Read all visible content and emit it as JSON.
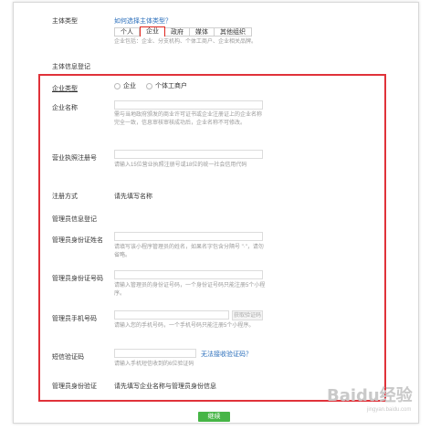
{
  "section_type": {
    "label": "主体类型",
    "help_link": "如何选择主体类型？",
    "tabs": [
      "个人",
      "企业",
      "政府",
      "媒体",
      "其他组织"
    ],
    "selected_tab": "企业",
    "description": "企业包括：企业、分支机构、个体工商户、企业相关品牌。"
  },
  "section_info": {
    "label": "主体信息登记"
  },
  "company_type": {
    "label": "企业类型",
    "options": [
      "企业",
      "个体工商户"
    ]
  },
  "company_name": {
    "label": "企业名称",
    "hint": "需与当地政府颁发的商业许可证书或企业注册证上的企业名称完全一致，信息审核审核成功后，企业名称不可修改。"
  },
  "license": {
    "label": "营业执照注册号",
    "hint": "请输入15位营业执照注册号或18位的统一社会信用代码"
  },
  "register_method": {
    "label": "注册方式",
    "value": "请先填写名称"
  },
  "admin_section": {
    "label": "管理员信息登记"
  },
  "admin_name": {
    "label": "管理员身份证姓名",
    "hint": "请填写该小程序管理员的姓名，如果名字包含分隔号 \"·\"，请勿省略。"
  },
  "admin_id": {
    "label": "管理员身份证号码",
    "hint": "请输入管理员的身份证号码，一个身份证号码只能注册5个小程序。"
  },
  "admin_phone": {
    "label": "管理员手机号码",
    "send_button": "获取验证码",
    "hint": "请输入您的手机号码，一个手机号码只能注册5个小程序。"
  },
  "sms": {
    "label": "短信验证码",
    "help_link": "无法接收验证码？",
    "hint": "请输入手机短信收到的6位验证码"
  },
  "admin_verify": {
    "label": "管理员身份验证",
    "value": "请先填写企业名称与管理员身份信息"
  },
  "continue_button": "继续",
  "watermark": {
    "logo": "Baidu经验",
    "sub": "jingyan.baidu.com"
  }
}
